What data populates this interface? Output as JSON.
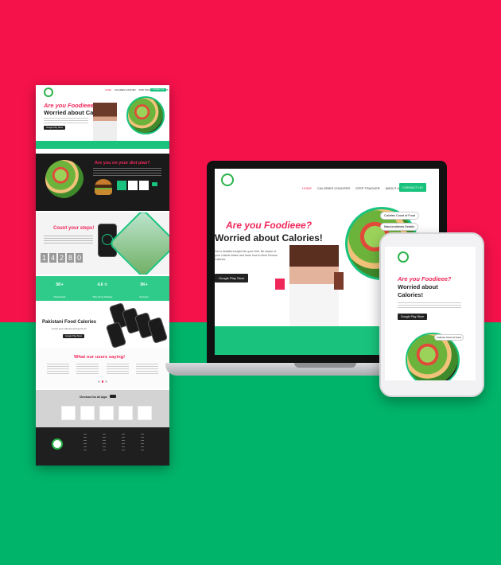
{
  "brand": {
    "accent": "#f5124b",
    "green": "#00b46a"
  },
  "nav": {
    "home": "HOME",
    "calories": "CALORIES COUNTER",
    "step": "STEP TRACKER",
    "about": "ABOUT US",
    "contact": "CONTACT US"
  },
  "hero": {
    "line1": "Are you Foodieee?",
    "line2": "Worried about Calories!",
    "desc": "Get a detailed insight into your Diet. Be aware of your Calorie intake and learn how to Burn Excess Calories.",
    "cta": "Google Play Store"
  },
  "chips": {
    "calories": "Calories Count of Food",
    "macro": "Macronutrients Details"
  },
  "diet": {
    "title": "Are you on your diet plan?"
  },
  "steps": {
    "title": "Count your steps!",
    "digits": [
      "1",
      "4",
      "2",
      "8",
      "0"
    ]
  },
  "stats": [
    {
      "value": "5K+",
      "label": "Downloads"
    },
    {
      "value": "4.6 ☆",
      "label": "Play Store Ratings"
    },
    {
      "value": "5K+",
      "label": "Reviews"
    }
  ],
  "app": {
    "title": "Pakistani Food Calories",
    "sub": "Count your calories and get fit in!"
  },
  "users": {
    "title": "What our users saying!"
  },
  "more": {
    "title": "Checkout Our All Apps"
  },
  "phone": {
    "line1": "Are you Foodieee?",
    "line2": "Worried about",
    "line3": "Calories!",
    "cta": "Google Play Store",
    "chip": "Calories Count of Food"
  }
}
